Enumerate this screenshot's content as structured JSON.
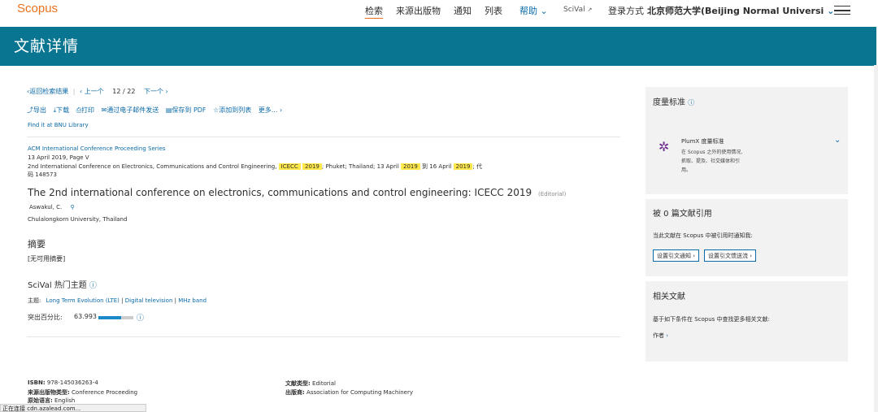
{
  "header": {
    "logo": "Scopus",
    "nav": {
      "search": "检索",
      "sources": "来源出版物",
      "alerts": "通知",
      "lists": "列表",
      "help": "帮助",
      "scival": "SciVal",
      "login_via": "登录方式",
      "institution": "北京师范大学(Beijing Normal Universi"
    }
  },
  "banner": {
    "title": "文献详情"
  },
  "doc_nav": {
    "back": "返回检索结果",
    "prev": "上一个",
    "current": "12",
    "separator": "/",
    "total": "22",
    "next": "下一个"
  },
  "toolbar": {
    "export": "导出",
    "download": "下载",
    "print": "打印",
    "email": "通过电子邮件发送",
    "pdf": "保存到 PDF",
    "add_list": "添加到列表",
    "more": "更多..."
  },
  "library_link": "Find it at BNU Library",
  "record": {
    "series": "ACM International Conference Proceeding Series",
    "date_page": "13 April 2019, Page V",
    "conf_prefix": "2nd International Conference on Electronics, Communications and Control Engineering, ",
    "conf_hl1": "ICECC",
    "conf_hl2": "2019",
    "conf_mid": "; Phuket; Thailand; 13 April ",
    "conf_hl3": "2019",
    "conf_mid2": " 到 16 April ",
    "conf_hl4": "2019",
    "conf_suffix": "; 代",
    "code": "码 148573",
    "title": "The 2nd international conference on electronics, communications and control engineering: ICECC 2019",
    "doc_label": "(Editorial)",
    "author": "Aswakul, C.",
    "affiliation": "Chulalongkorn University, Thailand"
  },
  "abstract": {
    "heading": "摘要",
    "text": "[无可用摘要]"
  },
  "scival": {
    "heading": "SciVal 热门主题",
    "topic_label": "主题:",
    "topics": [
      "Long Term Evolution (LTE)",
      "Digital television",
      "MHz band"
    ],
    "topic_sep": "|",
    "prominence_label": "突出百分比:",
    "prominence_value": "63.993",
    "prominence_fraction": 0.64
  },
  "footer": {
    "isbn_label": "ISBN:",
    "isbn": "978-145036263-4",
    "source_type_label": "来源出版物类型:",
    "source_type": "Conference Proceeding",
    "lang_label": "原始语言:",
    "lang": "English",
    "doc_type_label": "文献类型:",
    "doc_type": "Editorial",
    "publisher_label": "出版商:",
    "publisher": "Association for Computing Machinery"
  },
  "metrics": {
    "heading": "度量标准",
    "plumx_title": "PlumX 度量标准",
    "plumx_l1": "在 Scopus 之外的使用情况,",
    "plumx_l2": "抓取、提及、社交媒体和引",
    "plumx_l3": "用。"
  },
  "citations": {
    "heading": "被 0 篇文献引用",
    "notify_text": "当此文献在 Scopus 中被引用时通知我:",
    "alert_btn": "设置引文通知 ›",
    "feed_btn": "设置引文馈送流 ›"
  },
  "related": {
    "heading": "相关文献",
    "text": "基于如下条件在 Scopus 中查找更多相关文献:",
    "authors": "作者"
  },
  "status_bar": "正在连接 cdn.azalead.com..."
}
